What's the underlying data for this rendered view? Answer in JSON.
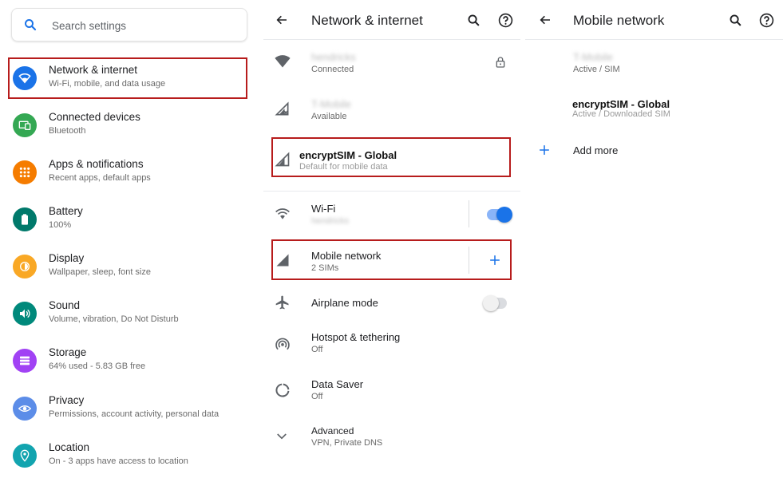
{
  "settings": {
    "search_placeholder": "Search settings",
    "items": [
      {
        "title": "Network & internet",
        "subtitle": "Wi-Fi, mobile, and data usage",
        "color": "#1a73e8",
        "icon": "wifi-icon"
      },
      {
        "title": "Connected devices",
        "subtitle": "Bluetooth",
        "color": "#34a853",
        "icon": "devices-icon"
      },
      {
        "title": "Apps & notifications",
        "subtitle": "Recent apps, default apps",
        "color": "#f57c00",
        "icon": "apps-icon"
      },
      {
        "title": "Battery",
        "subtitle": "100%",
        "color": "#00796b",
        "icon": "battery-icon"
      },
      {
        "title": "Display",
        "subtitle": "Wallpaper, sleep, font size",
        "color": "#f9a825",
        "icon": "display-icon"
      },
      {
        "title": "Sound",
        "subtitle": "Volume, vibration, Do Not Disturb",
        "color": "#00897b",
        "icon": "sound-icon"
      },
      {
        "title": "Storage",
        "subtitle": "64% used - 5.83 GB free",
        "color": "#a142f4",
        "icon": "storage-icon"
      },
      {
        "title": "Privacy",
        "subtitle": "Permissions, account activity, personal data",
        "color": "#5c8de8",
        "icon": "privacy-icon"
      },
      {
        "title": "Location",
        "subtitle": "On - 3 apps have access to location",
        "color": "#12a4af",
        "icon": "location-icon"
      }
    ]
  },
  "network": {
    "title": "Network & internet",
    "wifi_network": {
      "name": "hendricks",
      "status": "Connected"
    },
    "carrier": {
      "name": "T-Mobile",
      "status": "Available"
    },
    "encrypt_sim": {
      "name": "encryptSIM - Global",
      "status": "Default for mobile data"
    },
    "wifi": {
      "title": "Wi-Fi",
      "subtitle": "hendricks",
      "enabled": true
    },
    "mobile_network": {
      "title": "Mobile network",
      "subtitle": "2 SIMs"
    },
    "airplane": {
      "title": "Airplane mode",
      "enabled": false
    },
    "hotspot": {
      "title": "Hotspot & tethering",
      "subtitle": "Off"
    },
    "data_saver": {
      "title": "Data Saver",
      "subtitle": "Off"
    },
    "advanced": {
      "title": "Advanced",
      "subtitle": "VPN, Private DNS"
    }
  },
  "mobile": {
    "title": "Mobile network",
    "sim1": {
      "name": "T-Mobile",
      "status": "Active / SIM"
    },
    "sim2": {
      "name": "encryptSIM - Global",
      "status": "Active / Downloaded SIM"
    },
    "add_more": "Add more",
    "accent": "#1a73e8"
  }
}
